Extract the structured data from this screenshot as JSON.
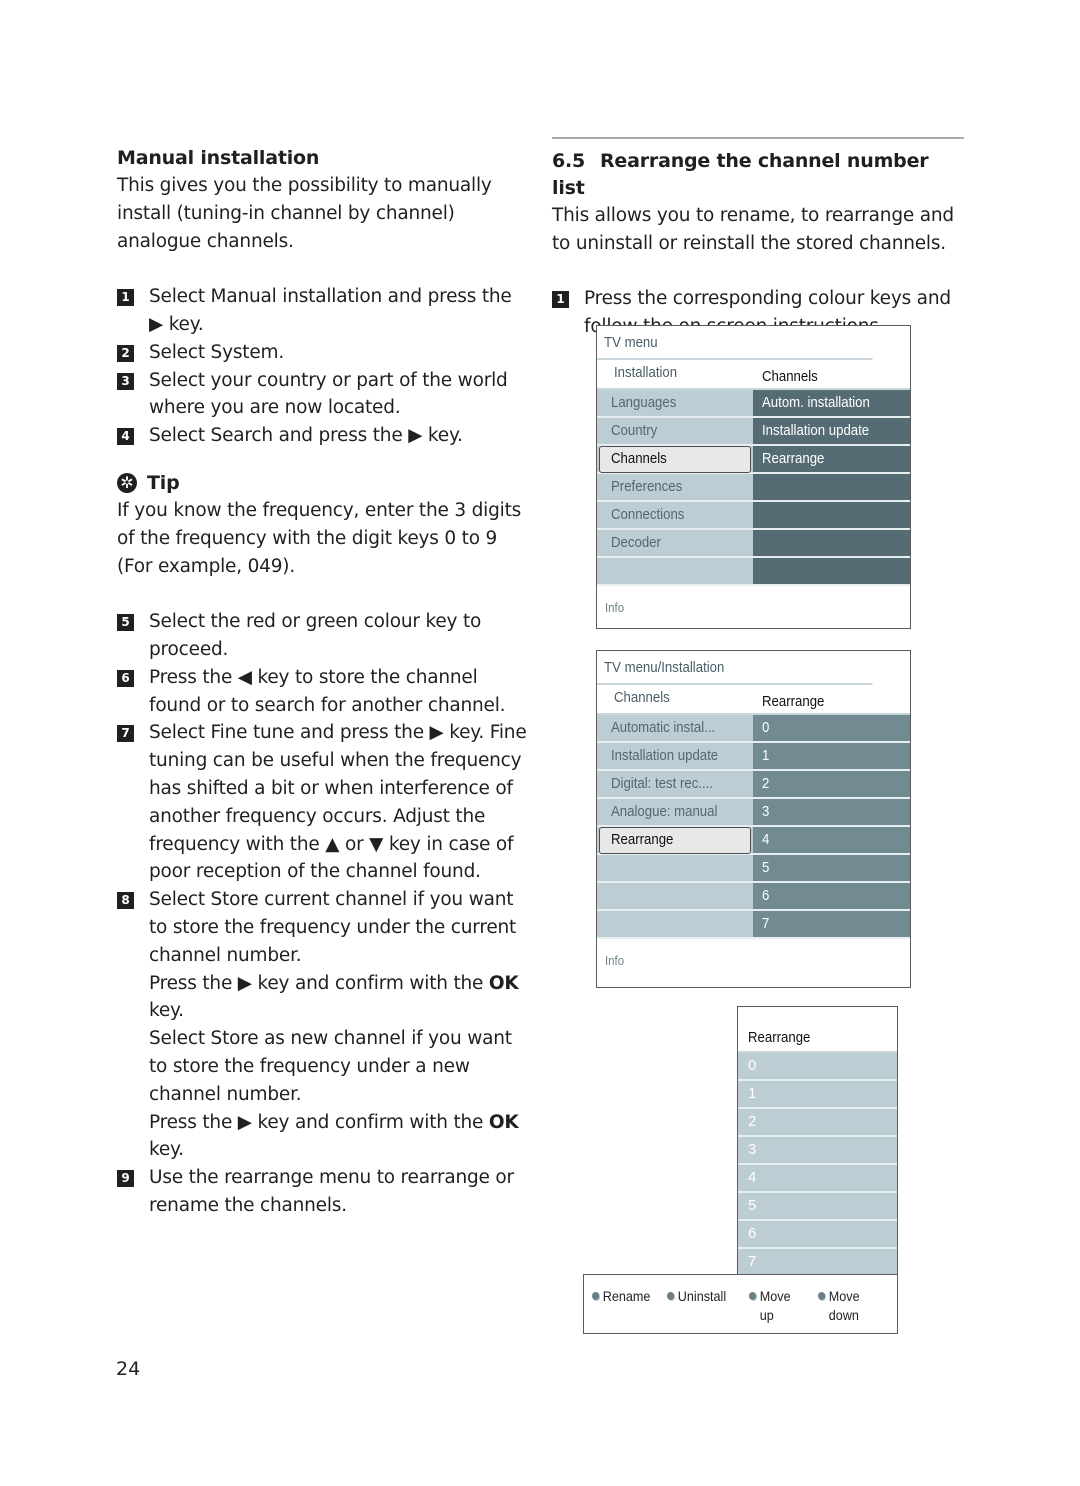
{
  "left": {
    "heading": "Manual installation",
    "intro": "This gives you the possibility to manually install (tuning-in channel by channel) analogue channels.",
    "steps_a": [
      {
        "num": "1",
        "text": "Select Manual installation and press the ▶ key."
      },
      {
        "num": "2",
        "text": "Select System."
      },
      {
        "num": "3",
        "text": "Select your country or part of the world where you are now located."
      },
      {
        "num": "4",
        "text": "Select Search and press the ▶ key."
      }
    ],
    "tip": {
      "icon": "✲",
      "title": "Tip",
      "text": "If you know the frequency, enter the 3 digits of the frequency with the digit keys 0 to 9 (For example, 049)."
    },
    "steps_b": [
      {
        "num": "5",
        "text": "Select the red or green colour key to proceed."
      },
      {
        "num": "6",
        "text": "Press the ◀ key to store the channel found or to search for another channel."
      },
      {
        "num": "7",
        "text": "Select Fine tune and press the ▶ key. Fine tuning can be useful when the frequency has shifted a bit or when interference of another frequency occurs. Adjust the frequency with the ▲ or ▼ key in case of poor reception of the channel found."
      },
      {
        "num": "8",
        "text": "Select Store current channel if you want to store the frequency under the current channel number."
      }
    ],
    "step8_cont": [
      {
        "pre": "Press the ▶ key and confirm with the ",
        "bold": "OK",
        "post": " key."
      },
      {
        "plain": "Select Store as new channel if you want to store the frequency under a new channel number."
      },
      {
        "pre": "Press the ▶ key and confirm with the ",
        "bold": "OK",
        "post": " key."
      }
    ],
    "step9": {
      "num": "9",
      "text": "Use the rearrange menu to rearrange or rename the channels."
    }
  },
  "right": {
    "section_num": "6.5",
    "section_title": "Rearrange the channel number list",
    "intro": "This allows you to rename, to rearrange and to uninstall or reinstall the stored channels.",
    "step1": {
      "num": "1",
      "text": "Press the corresponding colour keys and follow the on screen instructions."
    }
  },
  "menu1": {
    "title": "TV menu",
    "sub_left": "Installation",
    "sub_right": "Channels",
    "rows": [
      {
        "left": "Languages",
        "right": "Autom. installation"
      },
      {
        "left": "Country",
        "right": "Installation update"
      },
      {
        "left": "Channels",
        "right": "Rearrange",
        "selected": true
      },
      {
        "left": "Preferences",
        "right": ""
      },
      {
        "left": "Connections",
        "right": ""
      },
      {
        "left": "Decoder",
        "right": ""
      },
      {
        "left": "",
        "right": ""
      }
    ],
    "info": "Info"
  },
  "menu2": {
    "title": "TV menu/Installation",
    "sub_left": "Channels",
    "sub_right": "Rearrange",
    "rows": [
      {
        "left": "Automatic instal...",
        "right": "0"
      },
      {
        "left": "Installation update",
        "right": "1"
      },
      {
        "left": "Digital: test rec....",
        "right": "2"
      },
      {
        "left": "Analogue: manual",
        "right": "3"
      },
      {
        "left": "Rearrange",
        "right": "4",
        "selected": true
      },
      {
        "left": "",
        "right": "5"
      },
      {
        "left": "",
        "right": "6"
      },
      {
        "left": "",
        "right": "7"
      }
    ],
    "info": "Info"
  },
  "menu3": {
    "title": "Rearrange",
    "rows": [
      "0",
      "1",
      "2",
      "3",
      "4",
      "5",
      "6",
      "7"
    ]
  },
  "legend": [
    {
      "label": "Rename",
      "color": "red-key"
    },
    {
      "label": "Uninstall",
      "color": "green-key"
    },
    {
      "label": "Move up",
      "color": "yellow-key"
    },
    {
      "label": "Move down",
      "color": "blue-key"
    }
  ],
  "page_number": "24"
}
